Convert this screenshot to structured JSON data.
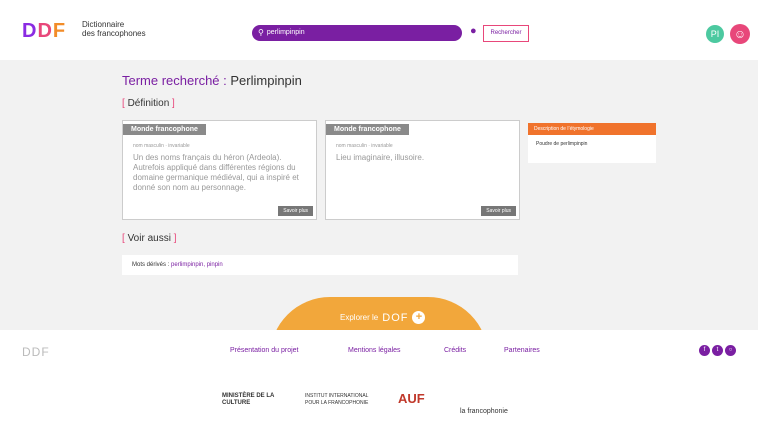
{
  "header": {
    "logo_letters": [
      "D",
      "D",
      "F"
    ],
    "logo_text_line1": "Dictionnaire",
    "logo_text_line2": "des francophones",
    "search_value": "perlimpinpin",
    "search_button": "Rechercher",
    "user_initials": "PI"
  },
  "main": {
    "term_label": "Terme recherché : ",
    "term": "Perlimpinpin",
    "definition_label": "Définition",
    "cards": [
      {
        "zone": "Monde francophone",
        "meta": "nom masculin · invariable",
        "body": "Un des noms français du héron (Ardeola). Autrefois appliqué dans différentes régions du domaine germanique médiéval, qui a inspiré et donné son nom au personnage.",
        "more": "Savoir plus"
      },
      {
        "zone": "Monde francophone",
        "meta": "nom masculin · invariable",
        "body": "Lieu imaginaire, illusoire.",
        "more": "Savoir plus"
      }
    ],
    "etymology": {
      "head": "Description de l’étymologie",
      "item": "Poudre de perlimpinpin"
    },
    "see_also_label": "Voir aussi",
    "derived_label": "Mots dérivés : ",
    "derived_value": "perlimpinpin, pinpin",
    "explore_label": "Explorer le",
    "explore_brand": "DOF"
  },
  "footer": {
    "logo": "DDF",
    "links": [
      "Présentation du projet",
      "Mentions légales",
      "Crédits",
      "Partenaires"
    ],
    "partners": [
      "MINISTÈRE DE LA CULTURE",
      "INSTITUT INTERNATIONAL POUR LA FRANCOPHONIE",
      "AUF",
      "la francophonie"
    ]
  },
  "colors": {
    "purple": "#7a1fa2",
    "pink": "#e8477a",
    "orange": "#f28c28",
    "teal": "#4cc9a0",
    "explore": "#f2a73b"
  }
}
